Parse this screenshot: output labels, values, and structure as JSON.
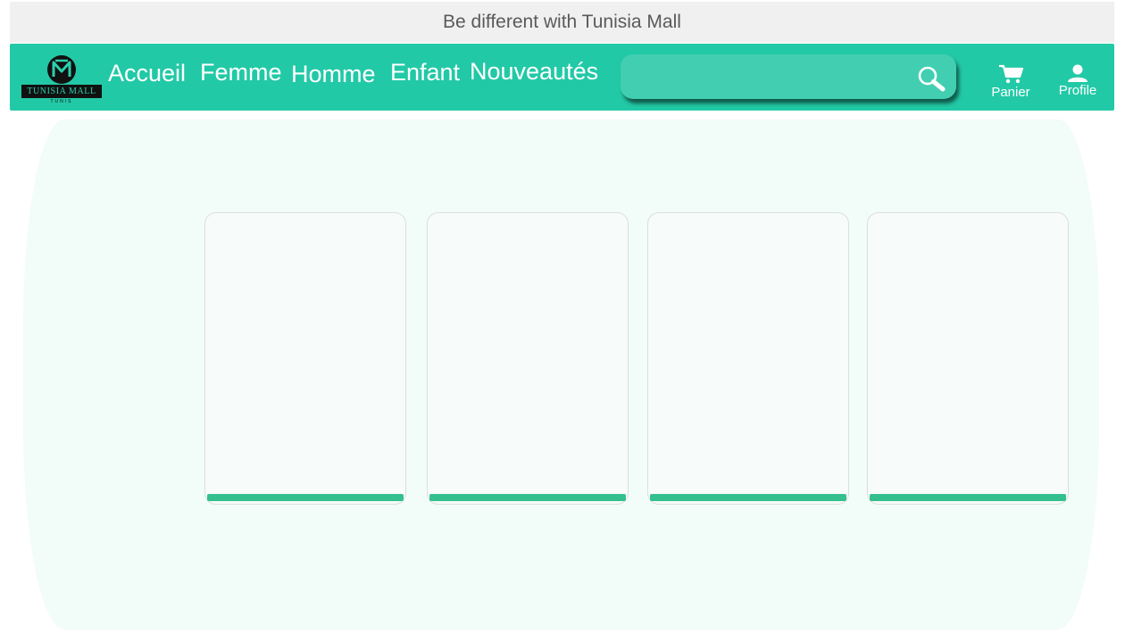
{
  "banner": {
    "text": "Be different with Tunisia Mall"
  },
  "brand": {
    "logo_text": "TUNISIA MALL",
    "logo_subtext": "TUNIS",
    "primary_color": "#22c9a6",
    "accent_color": "#34c08e"
  },
  "nav": {
    "links": [
      "Accueil",
      "Femme",
      "Homme",
      "Enfant",
      "Nouveautés"
    ]
  },
  "search": {
    "value": "",
    "placeholder": "",
    "icon": "search-icon"
  },
  "actions": {
    "cart": {
      "label": "Panier",
      "icon": "cart-icon"
    },
    "profile": {
      "label": "Profile",
      "icon": "user-icon"
    }
  },
  "products": [
    {},
    {},
    {},
    {}
  ]
}
